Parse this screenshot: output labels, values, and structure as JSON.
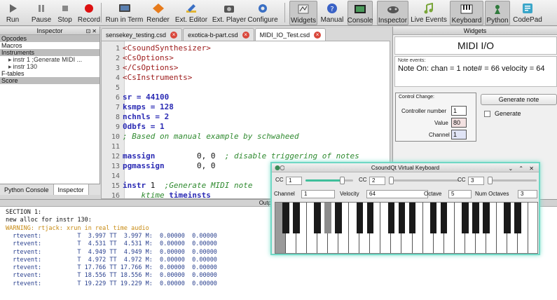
{
  "toolbar": {
    "buttons": [
      {
        "label": "Run",
        "icon": "play-icon"
      },
      {
        "label": "Pause",
        "icon": "pause-icon"
      },
      {
        "label": "Stop",
        "icon": "stop-icon"
      },
      {
        "label": "Record",
        "icon": "record-icon"
      },
      {
        "label": "Run in Term",
        "icon": "terminal-icon"
      },
      {
        "label": "Render",
        "icon": "render-icon"
      },
      {
        "label": "Ext. Editor",
        "icon": "pencil-icon"
      },
      {
        "label": "Ext. Player",
        "icon": "camera-icon"
      },
      {
        "label": "Configure",
        "icon": "gear-icon"
      },
      {
        "label": "Widgets",
        "icon": "widgets-icon"
      },
      {
        "label": "Manual",
        "icon": "help-icon"
      },
      {
        "label": "Console",
        "icon": "console-icon"
      },
      {
        "label": "Inspector",
        "icon": "gamepad-icon"
      },
      {
        "label": "Live Events",
        "icon": "music-note-icon"
      },
      {
        "label": "Keyboard",
        "icon": "keyboard-icon"
      },
      {
        "label": "Python",
        "icon": "python-icon"
      },
      {
        "label": "CodePad",
        "icon": "codepad-icon"
      }
    ]
  },
  "inspector": {
    "title": "Inspector",
    "tree": [
      {
        "label": "Opcodes",
        "child": false,
        "selected": true
      },
      {
        "label": "Macros",
        "child": false,
        "selected": false
      },
      {
        "label": "Instruments",
        "child": false,
        "selected": true
      },
      {
        "label": "instr 1 ;Generate MIDI ...",
        "child": true,
        "selected": false
      },
      {
        "label": "instr 130",
        "child": true,
        "selected": false
      },
      {
        "label": "F-tables",
        "child": false,
        "selected": false
      },
      {
        "label": "Score",
        "child": false,
        "selected": true
      }
    ],
    "bottom_tabs": [
      "Python Console",
      "Inspector"
    ]
  },
  "editor": {
    "tabs": [
      {
        "label": "sensekey_testing.csd",
        "active": false
      },
      {
        "label": "exotica-b-part.csd",
        "active": false
      },
      {
        "label": "MIDI_IO_Test.csd",
        "active": true
      }
    ],
    "close_glyph": "×",
    "lines": [
      {
        "n": "1",
        "parts": [
          {
            "t": "<CsoundSynthesizer>",
            "c": "tag"
          }
        ]
      },
      {
        "n": "2",
        "parts": [
          {
            "t": "<CsOptions>",
            "c": "tag"
          }
        ]
      },
      {
        "n": "3",
        "parts": [
          {
            "t": "</CsOptions>",
            "c": "tag"
          }
        ]
      },
      {
        "n": "4",
        "parts": [
          {
            "t": "<CsInstruments>",
            "c": "tag"
          }
        ]
      },
      {
        "n": "5",
        "parts": []
      },
      {
        "n": "6",
        "parts": [
          {
            "t": "sr",
            "c": "kw"
          },
          {
            "t": " = 44100",
            "c": "kw"
          }
        ]
      },
      {
        "n": "7",
        "parts": [
          {
            "t": "ksmps",
            "c": "kw"
          },
          {
            "t": " = 128",
            "c": "kw"
          }
        ]
      },
      {
        "n": "8",
        "parts": [
          {
            "t": "nchnls",
            "c": "kw"
          },
          {
            "t": " = 2",
            "c": "kw"
          }
        ]
      },
      {
        "n": "9",
        "parts": [
          {
            "t": "0dbfs",
            "c": "kw"
          },
          {
            "t": " = 1",
            "c": "kw"
          }
        ]
      },
      {
        "n": "10",
        "parts": [
          {
            "t": "; Based on manual example by schwaheed",
            "c": "cmt"
          }
        ]
      },
      {
        "n": "11",
        "parts": []
      },
      {
        "n": "12",
        "parts": [
          {
            "t": "massign",
            "c": "kw"
          },
          {
            "t": "         0, 0  ",
            "c": "plain"
          },
          {
            "t": "; disable triggering of notes",
            "c": "cmt"
          }
        ]
      },
      {
        "n": "13",
        "parts": [
          {
            "t": "pgmassign",
            "c": "kw"
          },
          {
            "t": "       0, 0",
            "c": "plain"
          }
        ]
      },
      {
        "n": "14",
        "parts": []
      },
      {
        "n": "15",
        "parts": [
          {
            "t": "instr",
            "c": "kw"
          },
          {
            "t": " 1  ",
            "c": "plain"
          },
          {
            "t": ";Generate MIDI note",
            "c": "cmt"
          }
        ]
      },
      {
        "n": "16",
        "parts": [
          {
            "t": "    ",
            "c": "plain"
          },
          {
            "t": "ktime",
            "c": "cmt"
          },
          {
            "t": " timeinsts",
            "c": "kw"
          }
        ]
      }
    ]
  },
  "console": {
    "title": "Output Console",
    "lines": [
      {
        "t": "SECTION 1:",
        "c": ""
      },
      {
        "t": "new alloc for instr 130:",
        "c": ""
      },
      {
        "t": "WARNING: rtjack: xrun in real time audio",
        "c": "warn"
      },
      {
        "t": "  rtevent:          T  3.997 TT  3.997 M:  0.00000  0.00000",
        "c": "ev"
      },
      {
        "t": "  rtevent:          T  4.531 TT  4.531 M:  0.00000  0.00000",
        "c": "ev"
      },
      {
        "t": "  rtevent:          T  4.949 TT  4.949 M:  0.00000  0.00000",
        "c": "ev"
      },
      {
        "t": "  rtevent:          T  4.972 TT  4.972 M:  0.00000  0.00000",
        "c": "ev"
      },
      {
        "t": "  rtevent:          T 17.766 TT 17.766 M:  0.00000  0.00000",
        "c": "ev"
      },
      {
        "t": "  rtevent:          T 18.556 TT 18.556 M:  0.00000  0.00000",
        "c": "ev"
      },
      {
        "t": "  rtevent:          T 19.229 TT 19.229 M:  0.00000  0.00000",
        "c": "ev"
      }
    ]
  },
  "widgets": {
    "title": "Widgets",
    "panel_title": "MIDI I/O",
    "note_events_label": "Note events:",
    "note_text": "Note On: chan = 1 note#  = 66 velocity = 64",
    "control_change_label": "Control Change:",
    "controller_number_label": "Controller number",
    "controller_number": "1",
    "value_label": "Value",
    "value": "80",
    "channel_label": "Channel",
    "channel": "1",
    "generate_note_label": "Generate note",
    "generate_label": "Generate"
  },
  "keyboard": {
    "title": "CsoundQt Virtual Keyboard",
    "title_buttons": "⌄ ⌃ ✕",
    "cc_label": "CC",
    "cc1": "1",
    "cc1_level": 0.8,
    "cc2": "2",
    "cc2_level": 0.0,
    "cc3": "3",
    "cc3_level": 0.0,
    "channel_label": "Channel",
    "channel": "1",
    "velocity_label": "Velocity",
    "velocity": "64",
    "octave_label": "Octave",
    "octave": "5",
    "num_octaves_label": "Num Octaves",
    "num_octaves": "3",
    "accent_color": "#6fd7c4"
  }
}
